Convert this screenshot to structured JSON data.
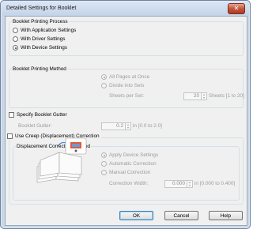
{
  "window": {
    "title": "Detailed Settings for Booklet",
    "close_icon": "close-icon"
  },
  "printing_process": {
    "title": "Booklet Printing Process",
    "options": [
      {
        "label": "With Application Settings",
        "checked": false
      },
      {
        "label": "With Driver Settings",
        "checked": false
      },
      {
        "label": "With Device Settings",
        "checked": true
      }
    ]
  },
  "printing_method": {
    "title": "Booklet Printing Method",
    "options": [
      {
        "label": "All Pages at Once",
        "checked": true
      },
      {
        "label": "Divide into Sets",
        "checked": false
      }
    ],
    "sheets_per_set": {
      "label": "Sheets per Set:",
      "value": "20",
      "unit": "Sheets [1 to 20]"
    }
  },
  "gutter": {
    "checkbox_label": "Specify Booklet Gutter",
    "label": "Booklet Gutter:",
    "value": "0.2",
    "unit": "in [0.0 to 2.0]"
  },
  "creep": {
    "checkbox_label": "Use Creep (Displacement) Correction",
    "method_title": "Displacement Correction Method",
    "options": [
      {
        "label": "Apply Device Settings",
        "checked": true
      },
      {
        "label": "Automatic Correction",
        "checked": false
      },
      {
        "label": "Manual Correction",
        "checked": false
      }
    ],
    "correction_width": {
      "label": "Correction Width:",
      "value": "0.000",
      "unit": "in [0.000 to 0.400]"
    }
  },
  "buttons": {
    "ok": "OK",
    "cancel": "Cancel",
    "help": "Help"
  }
}
